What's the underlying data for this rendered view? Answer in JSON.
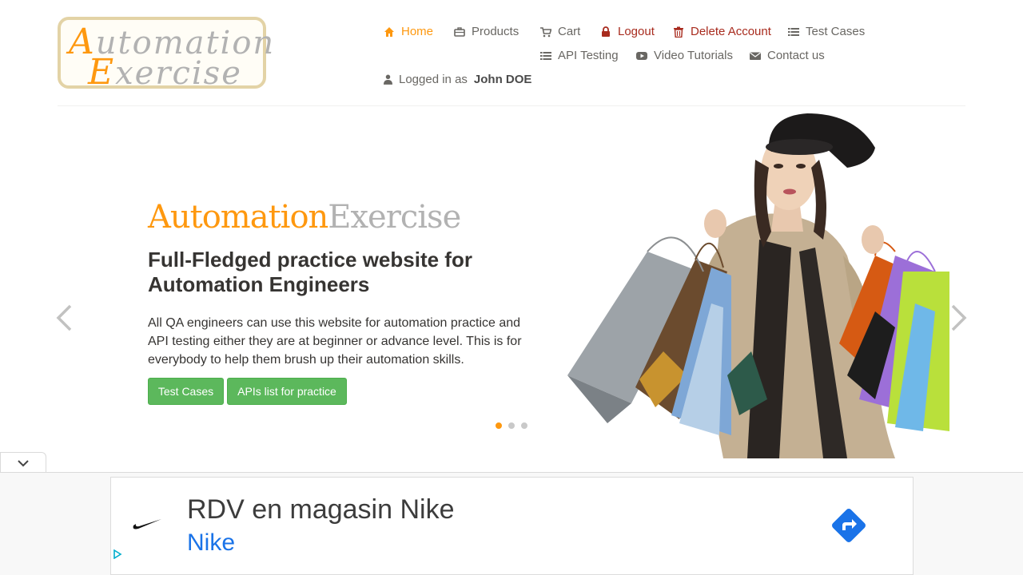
{
  "logo": {
    "line1_cap": "A",
    "line1_rest": "utomation",
    "line2_cap": "E",
    "line2_rest": "xercise"
  },
  "nav": {
    "home": "Home",
    "products": "Products",
    "cart": "Cart",
    "logout": "Logout",
    "delete_account": "Delete Account",
    "test_cases": "Test Cases",
    "api_testing": "API Testing",
    "video_tutorials": "Video Tutorials",
    "contact_us": "Contact us",
    "logged_in_prefix": "Logged in as",
    "logged_in_user": "John DOE"
  },
  "hero": {
    "title_part1": "Automation",
    "title_part2": "Exercise",
    "subtitle": "Full-Fledged practice website for Automation Engineers",
    "description": "All QA engineers can use this website for automation practice and API testing either they are at beginner or advance level. This is for everybody to help them brush up their automation skills.",
    "btn_test_cases": "Test Cases",
    "btn_apis": "APIs list for practice",
    "prev_arrow": "‹",
    "next_arrow": "›",
    "slide_count": 3,
    "active_slide": 1
  },
  "ad": {
    "headline": "RDV en magasin Nike",
    "brand": "Nike",
    "toggle_glyph": "⌄"
  },
  "colors": {
    "accent": "#fe980f",
    "danger": "#a82b1e",
    "button_green": "#5cb85c",
    "ad_blue": "#1a73e8"
  }
}
